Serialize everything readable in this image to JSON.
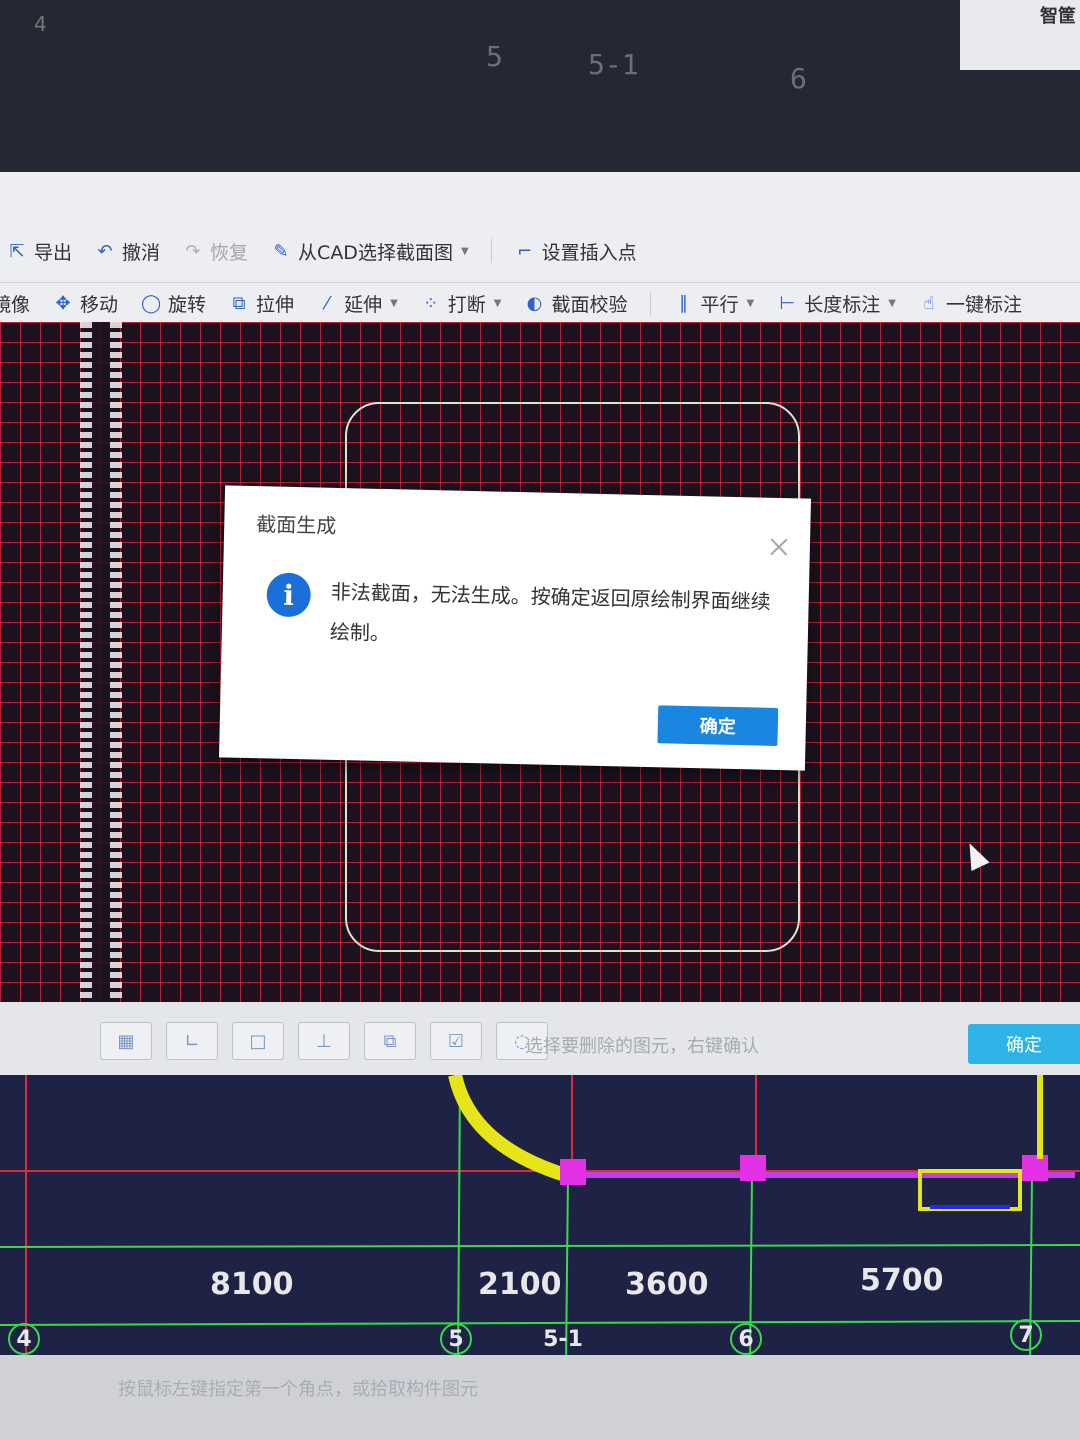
{
  "top": {
    "corner_label": "4",
    "axis_labels": [
      "5",
      "5-1",
      "6"
    ],
    "right_label": "智筐"
  },
  "toolbar1": {
    "export": "导出",
    "undo": "撤消",
    "redo": "恢复",
    "from_cad": "从CAD选择截面图",
    "set_insert_point": "设置插入点"
  },
  "toolbar2": {
    "mirror": "镜像",
    "move": "移动",
    "rotate": "旋转",
    "stretch": "拉伸",
    "extend": "延伸",
    "break": "打断",
    "section_check": "截面校验",
    "parallel": "平行",
    "length_dim": "长度标注",
    "one_click_dim": "一键标注"
  },
  "dialog": {
    "title": "截面生成",
    "message": "非法截面，无法生成。按确定返回原绘制界面继续绘制。",
    "ok_label": "确定"
  },
  "status": {
    "hint": "选择要删除的图元，右键确认",
    "ok_label": "确定"
  },
  "plan": {
    "dimensions": [
      "8100",
      "2100",
      "3600",
      "5700"
    ],
    "grid_labels": [
      "4",
      "5",
      "5-1",
      "6",
      "7"
    ],
    "hint": "按鼠标左键指定第一个角点，或拾取构件图元"
  },
  "colors": {
    "grid_line": "#eb283c",
    "dialog_ok": "#1a86df",
    "status_ok": "#2eb3e6",
    "plan_bg": "#1e2245",
    "axis_green": "#38d94a"
  }
}
